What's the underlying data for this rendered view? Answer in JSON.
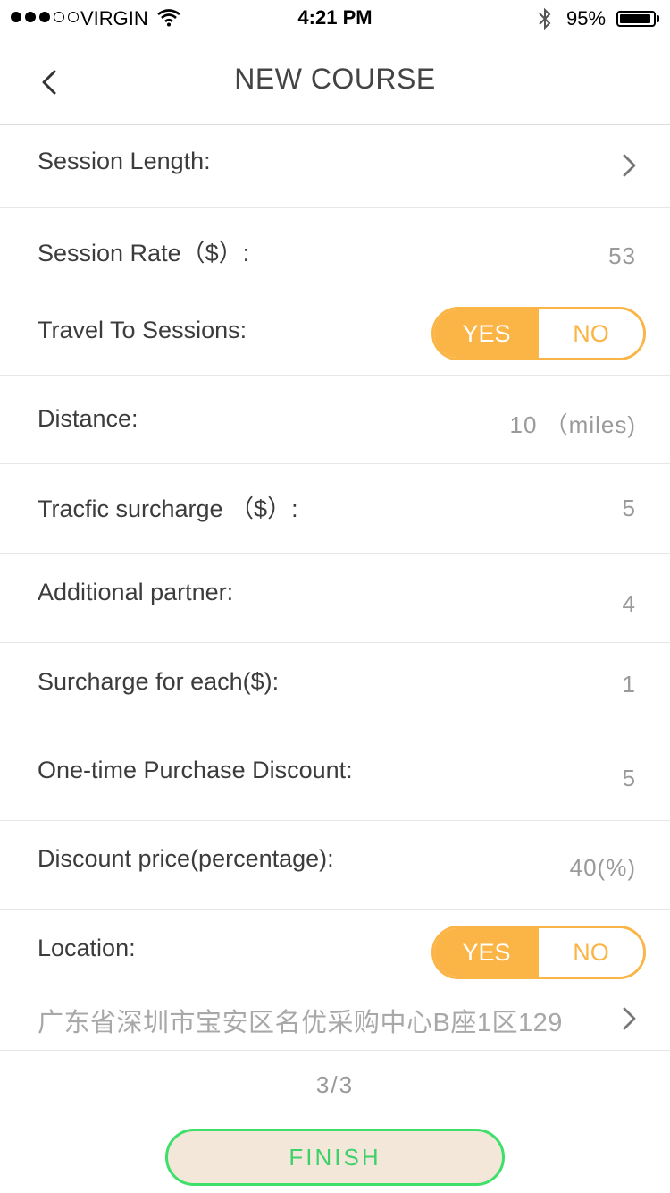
{
  "status_bar": {
    "carrier": "VIRGIN",
    "time": "4:21 PM",
    "battery": "95%",
    "battery_level": 0.95,
    "signal_bars": 3,
    "signal_max": 5
  },
  "nav": {
    "title": "NEW COURSE",
    "back_icon": "chevron-left-icon"
  },
  "rows": {
    "session_length": {
      "label": "Session Length:"
    },
    "session_rate": {
      "label": "Session Rate（$）:",
      "value": "53"
    },
    "travel": {
      "label": "Travel To Sessions:",
      "yes": "YES",
      "no": "NO",
      "selected": "YES"
    },
    "distance": {
      "label": "Distance:",
      "value": "10 （miles)"
    },
    "traffic": {
      "label": "Tracfic surcharge （$）:",
      "value": "5"
    },
    "partner": {
      "label": "Additional partner:",
      "value": "4"
    },
    "surcharge_each": {
      "label": "Surcharge for each($):",
      "value": "1"
    },
    "one_time": {
      "label": "One-time Purchase Discount:",
      "value": "5"
    },
    "discount_price": {
      "label": "Discount price(percentage):",
      "value": "40(%)"
    },
    "location": {
      "label": "Location:",
      "yes": "YES",
      "no": "NO",
      "selected": "YES",
      "address": "广东省深圳市宝安区名优采购中心B座1区129"
    }
  },
  "footer": {
    "page_indicator": "3/3",
    "finish_label": "FINISH"
  },
  "colors": {
    "accent": "#fbb446",
    "finish_border": "#3ee06a",
    "finish_bg": "#f3e7da"
  }
}
